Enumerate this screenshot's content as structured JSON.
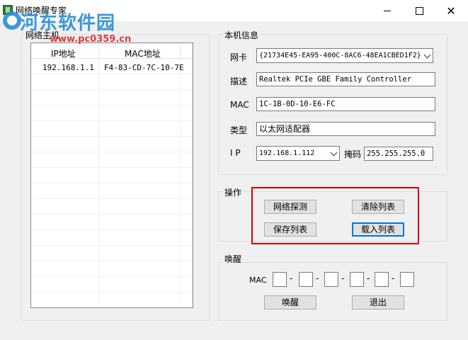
{
  "window": {
    "title": "网络唤醒专家",
    "watermark": "河东软件园",
    "watermark_url": "www.pc0359.cn"
  },
  "hosts_panel": {
    "legend": "网络主机",
    "columns": [
      "IP地址",
      "MAC地址"
    ],
    "rows": [
      {
        "ip": "192.168.1.1",
        "mac": "F4-83-CD-7C-10-7E"
      }
    ]
  },
  "local_info": {
    "legend": "本机信息",
    "nic_label": "网卡",
    "nic_value": "{21734E45-EA95-400C-8AC6-48EA1CBED1F2}",
    "desc_label": "描述",
    "desc_value": "Realtek PCIe GBE Family Controller",
    "mac_label": "MAC",
    "mac_value": "1C-1B-0D-10-E6-FC",
    "type_label": "类型",
    "type_value": "以太网适配器",
    "ip_label": "I P",
    "ip_value": "192.168.1.112",
    "mask_label": "掩码",
    "mask_value": "255.255.255.0"
  },
  "operations": {
    "legend": "操作",
    "detect": "网络探测",
    "clear": "清除列表",
    "save": "保存列表",
    "load": "载入列表"
  },
  "wake": {
    "legend": "唤醒",
    "mac_label": "MAC",
    "wake_button": "唤醒",
    "exit_button": "退出"
  },
  "colors": {
    "highlight_frame": "#d40000",
    "focus_border": "#0078d7"
  },
  "icons": {
    "app": "app-icon",
    "minimize": "minimize-icon",
    "maximize": "maximize-icon",
    "close": "close-icon",
    "dropdown": "chevron-down-icon"
  }
}
